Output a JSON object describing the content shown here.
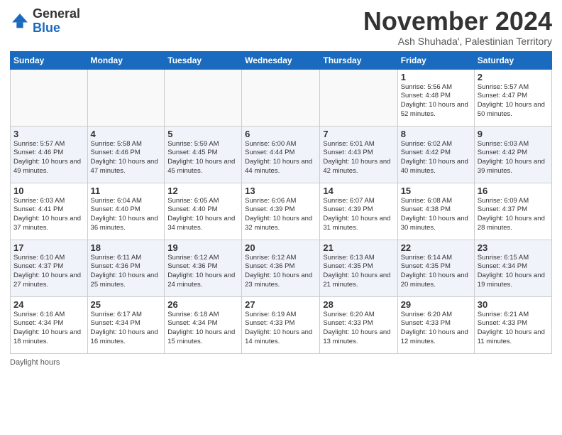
{
  "logo": {
    "general": "General",
    "blue": "Blue"
  },
  "header": {
    "month": "November 2024",
    "location": "Ash Shuhada', Palestinian Territory"
  },
  "weekdays": [
    "Sunday",
    "Monday",
    "Tuesday",
    "Wednesday",
    "Thursday",
    "Friday",
    "Saturday"
  ],
  "footer": {
    "daylight_label": "Daylight hours"
  },
  "weeks": [
    [
      {
        "day": "",
        "info": ""
      },
      {
        "day": "",
        "info": ""
      },
      {
        "day": "",
        "info": ""
      },
      {
        "day": "",
        "info": ""
      },
      {
        "day": "",
        "info": ""
      },
      {
        "day": "1",
        "info": "Sunrise: 5:56 AM\nSunset: 4:48 PM\nDaylight: 10 hours\nand 52 minutes."
      },
      {
        "day": "2",
        "info": "Sunrise: 5:57 AM\nSunset: 4:47 PM\nDaylight: 10 hours\nand 50 minutes."
      }
    ],
    [
      {
        "day": "3",
        "info": "Sunrise: 5:57 AM\nSunset: 4:46 PM\nDaylight: 10 hours\nand 49 minutes."
      },
      {
        "day": "4",
        "info": "Sunrise: 5:58 AM\nSunset: 4:46 PM\nDaylight: 10 hours\nand 47 minutes."
      },
      {
        "day": "5",
        "info": "Sunrise: 5:59 AM\nSunset: 4:45 PM\nDaylight: 10 hours\nand 45 minutes."
      },
      {
        "day": "6",
        "info": "Sunrise: 6:00 AM\nSunset: 4:44 PM\nDaylight: 10 hours\nand 44 minutes."
      },
      {
        "day": "7",
        "info": "Sunrise: 6:01 AM\nSunset: 4:43 PM\nDaylight: 10 hours\nand 42 minutes."
      },
      {
        "day": "8",
        "info": "Sunrise: 6:02 AM\nSunset: 4:42 PM\nDaylight: 10 hours\nand 40 minutes."
      },
      {
        "day": "9",
        "info": "Sunrise: 6:03 AM\nSunset: 4:42 PM\nDaylight: 10 hours\nand 39 minutes."
      }
    ],
    [
      {
        "day": "10",
        "info": "Sunrise: 6:03 AM\nSunset: 4:41 PM\nDaylight: 10 hours\nand 37 minutes."
      },
      {
        "day": "11",
        "info": "Sunrise: 6:04 AM\nSunset: 4:40 PM\nDaylight: 10 hours\nand 36 minutes."
      },
      {
        "day": "12",
        "info": "Sunrise: 6:05 AM\nSunset: 4:40 PM\nDaylight: 10 hours\nand 34 minutes."
      },
      {
        "day": "13",
        "info": "Sunrise: 6:06 AM\nSunset: 4:39 PM\nDaylight: 10 hours\nand 32 minutes."
      },
      {
        "day": "14",
        "info": "Sunrise: 6:07 AM\nSunset: 4:39 PM\nDaylight: 10 hours\nand 31 minutes."
      },
      {
        "day": "15",
        "info": "Sunrise: 6:08 AM\nSunset: 4:38 PM\nDaylight: 10 hours\nand 30 minutes."
      },
      {
        "day": "16",
        "info": "Sunrise: 6:09 AM\nSunset: 4:37 PM\nDaylight: 10 hours\nand 28 minutes."
      }
    ],
    [
      {
        "day": "17",
        "info": "Sunrise: 6:10 AM\nSunset: 4:37 PM\nDaylight: 10 hours\nand 27 minutes."
      },
      {
        "day": "18",
        "info": "Sunrise: 6:11 AM\nSunset: 4:36 PM\nDaylight: 10 hours\nand 25 minutes."
      },
      {
        "day": "19",
        "info": "Sunrise: 6:12 AM\nSunset: 4:36 PM\nDaylight: 10 hours\nand 24 minutes."
      },
      {
        "day": "20",
        "info": "Sunrise: 6:12 AM\nSunset: 4:36 PM\nDaylight: 10 hours\nand 23 minutes."
      },
      {
        "day": "21",
        "info": "Sunrise: 6:13 AM\nSunset: 4:35 PM\nDaylight: 10 hours\nand 21 minutes."
      },
      {
        "day": "22",
        "info": "Sunrise: 6:14 AM\nSunset: 4:35 PM\nDaylight: 10 hours\nand 20 minutes."
      },
      {
        "day": "23",
        "info": "Sunrise: 6:15 AM\nSunset: 4:34 PM\nDaylight: 10 hours\nand 19 minutes."
      }
    ],
    [
      {
        "day": "24",
        "info": "Sunrise: 6:16 AM\nSunset: 4:34 PM\nDaylight: 10 hours\nand 18 minutes."
      },
      {
        "day": "25",
        "info": "Sunrise: 6:17 AM\nSunset: 4:34 PM\nDaylight: 10 hours\nand 16 minutes."
      },
      {
        "day": "26",
        "info": "Sunrise: 6:18 AM\nSunset: 4:34 PM\nDaylight: 10 hours\nand 15 minutes."
      },
      {
        "day": "27",
        "info": "Sunrise: 6:19 AM\nSunset: 4:33 PM\nDaylight: 10 hours\nand 14 minutes."
      },
      {
        "day": "28",
        "info": "Sunrise: 6:20 AM\nSunset: 4:33 PM\nDaylight: 10 hours\nand 13 minutes."
      },
      {
        "day": "29",
        "info": "Sunrise: 6:20 AM\nSunset: 4:33 PM\nDaylight: 10 hours\nand 12 minutes."
      },
      {
        "day": "30",
        "info": "Sunrise: 6:21 AM\nSunset: 4:33 PM\nDaylight: 10 hours\nand 11 minutes."
      }
    ]
  ]
}
